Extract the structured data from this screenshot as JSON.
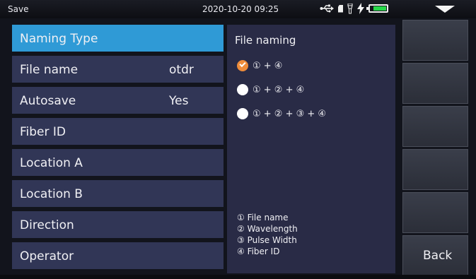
{
  "status": {
    "title": "Save",
    "datetime": "2020-10-20 09:25",
    "icons": [
      "usb-icon",
      "sd-card-icon",
      "flashlight-icon",
      "charging-icon",
      "battery-icon",
      "menu-toggle-icon"
    ],
    "battery_level": 0.8,
    "battery_color": "#27d84a"
  },
  "items": [
    {
      "label": "Naming Type",
      "value": ""
    },
    {
      "label": "File name",
      "value": "otdr"
    },
    {
      "label": "Autosave",
      "value": "Yes"
    },
    {
      "label": "Fiber ID",
      "value": ""
    },
    {
      "label": "Location A",
      "value": ""
    },
    {
      "label": "Location B",
      "value": ""
    },
    {
      "label": "Direction",
      "value": ""
    },
    {
      "label": "Operator",
      "value": ""
    }
  ],
  "naming": {
    "title": "File naming",
    "options": [
      {
        "label": "① + ④",
        "selected": true
      },
      {
        "label": "① + ② + ④",
        "selected": false
      },
      {
        "label": "① + ② + ③ + ④",
        "selected": false
      }
    ],
    "legend": [
      "① File name",
      "② Wavelength",
      "③ Pulse Width",
      "④ Fiber ID"
    ]
  },
  "softkeys": {
    "back_label": "Back"
  },
  "colors": {
    "active_item": "#2f9ad6",
    "item_bg": "#313656",
    "panel_bg": "#292b46",
    "radio_checked": "#ee8c3b"
  }
}
